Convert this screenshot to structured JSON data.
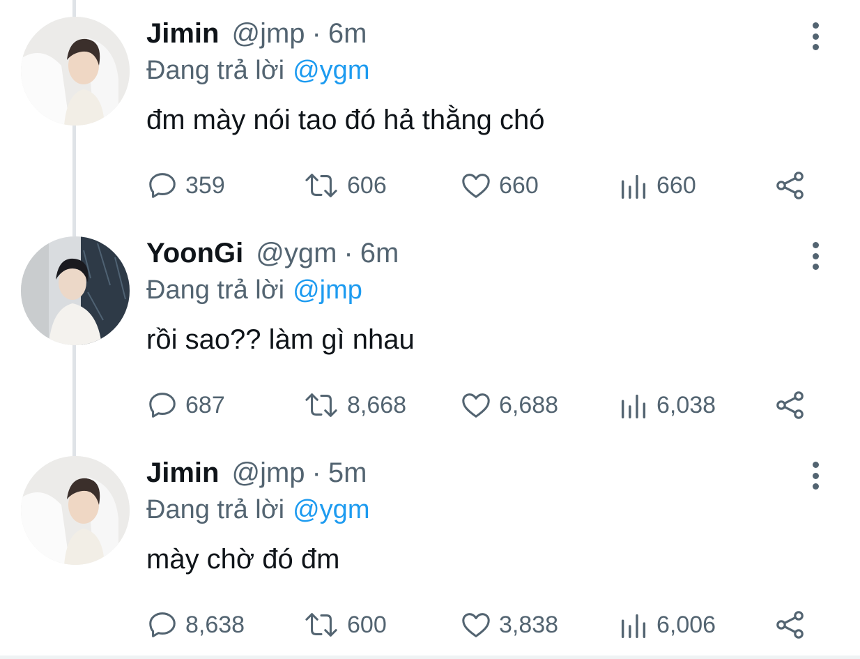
{
  "tweets": [
    {
      "display_name": "Jimin",
      "handle": "@jmp",
      "separator": "·",
      "time": "6m",
      "reply_prefix": "Đang trả lời",
      "reply_to": "@ygm",
      "text": "đm mày nói tao đó hả thằng chó",
      "avatar_icon": "avatar-jimin",
      "stats": {
        "replies": "359",
        "retweets": "606",
        "likes": "660",
        "views": "660"
      }
    },
    {
      "display_name": "YoonGi",
      "handle": "@ygm",
      "separator": "·",
      "time": "6m",
      "reply_prefix": "Đang trả lời",
      "reply_to": "@jmp",
      "text": "rồi sao?? làm gì nhau",
      "avatar_icon": "avatar-yoongi",
      "stats": {
        "replies": "687",
        "retweets": "8,668",
        "likes": "6,688",
        "views": "6,038"
      }
    },
    {
      "display_name": "Jimin",
      "handle": "@jmp",
      "separator": "·",
      "time": "5m",
      "reply_prefix": "Đang trả lời",
      "reply_to": "@ygm",
      "text": "mày chờ đó đm",
      "avatar_icon": "avatar-jimin",
      "stats": {
        "replies": "8,638",
        "retweets": "600",
        "likes": "3,838",
        "views": "6,006"
      }
    }
  ],
  "icons": {
    "reply": "reply-icon",
    "retweet": "retweet-icon",
    "like": "heart-icon",
    "views": "views-icon",
    "share": "share-icon",
    "more": "more-vertical-icon"
  },
  "colors": {
    "text_primary": "#0f1419",
    "text_secondary": "#536471",
    "mention": "#1d9bf0",
    "thread_line": "#dfe3e7"
  }
}
